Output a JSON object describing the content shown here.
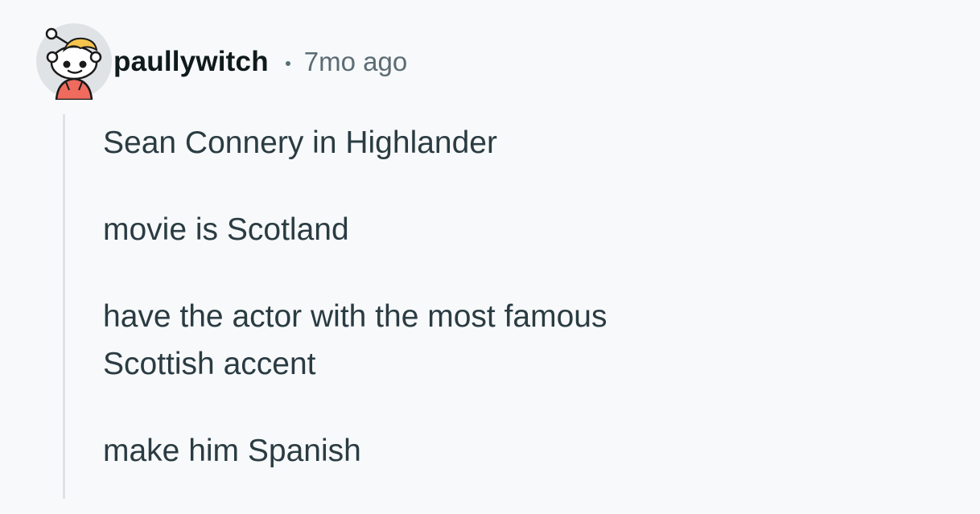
{
  "comment": {
    "author": "paullywitch",
    "separator_icon": "dot-separator",
    "timestamp": "7mo ago",
    "avatar_icon": "snoo-avatar-icon",
    "paragraphs": [
      "Sean Connery in Highlander",
      "movie is Scotland",
      "have the actor with the most famous",
      "Scottish accent",
      "make him Spanish"
    ]
  },
  "colors": {
    "background": "#f8f9fb",
    "username": "#0f1a1c",
    "timestamp": "#5c6c74",
    "body_text": "#2a3c42",
    "thread_line": "#dfe3e8"
  }
}
